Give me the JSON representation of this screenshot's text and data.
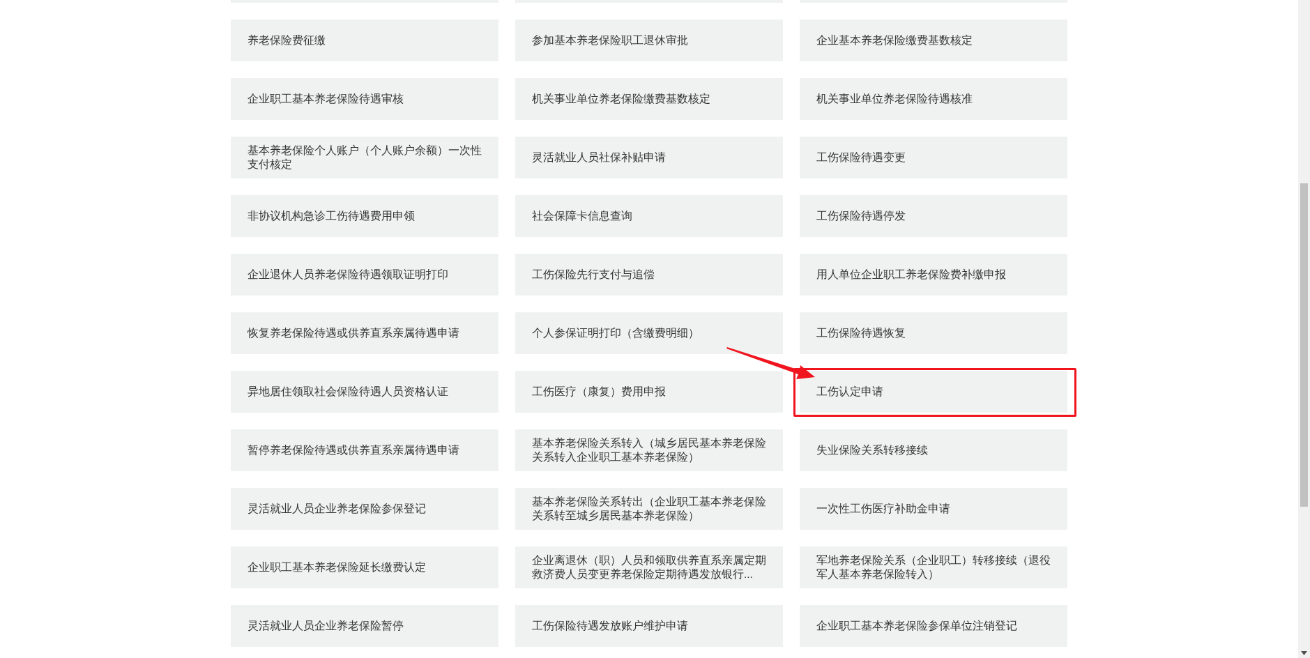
{
  "rows": [
    {
      "services": [
        {
          "label": "养老保险费征缴",
          "highlighted": false
        },
        {
          "label": "参加基本养老保险职工退休审批",
          "highlighted": false
        },
        {
          "label": "企业基本养老保险缴费基数核定",
          "highlighted": false
        }
      ]
    },
    {
      "services": [
        {
          "label": "企业职工基本养老保险待遇审核",
          "highlighted": false
        },
        {
          "label": "机关事业单位养老保险缴费基数核定",
          "highlighted": false
        },
        {
          "label": "机关事业单位养老保险待遇核准",
          "highlighted": false
        }
      ]
    },
    {
      "services": [
        {
          "label": "基本养老保险个人账户（个人账户余额）一次性支付核定",
          "highlighted": false
        },
        {
          "label": "灵活就业人员社保补贴申请",
          "highlighted": false
        },
        {
          "label": "工伤保险待遇变更",
          "highlighted": false
        }
      ]
    },
    {
      "services": [
        {
          "label": "非协议机构急诊工伤待遇费用申领",
          "highlighted": false
        },
        {
          "label": "社会保障卡信息查询",
          "highlighted": false
        },
        {
          "label": "工伤保险待遇停发",
          "highlighted": false
        }
      ]
    },
    {
      "services": [
        {
          "label": "企业退休人员养老保险待遇领取证明打印",
          "highlighted": false
        },
        {
          "label": "工伤保险先行支付与追偿",
          "highlighted": false
        },
        {
          "label": "用人单位企业职工养老保险费补缴申报",
          "highlighted": false
        }
      ]
    },
    {
      "services": [
        {
          "label": "恢复养老保险待遇或供养直系亲属待遇申请",
          "highlighted": false
        },
        {
          "label": "个人参保证明打印（含缴费明细）",
          "highlighted": false
        },
        {
          "label": "工伤保险待遇恢复",
          "highlighted": false
        }
      ]
    },
    {
      "services": [
        {
          "label": "异地居住领取社会保险待遇人员资格认证",
          "highlighted": false
        },
        {
          "label": "工伤医疗（康复）费用申报",
          "highlighted": false
        },
        {
          "label": "工伤认定申请",
          "highlighted": true
        }
      ]
    },
    {
      "services": [
        {
          "label": "暂停养老保险待遇或供养直系亲属待遇申请",
          "highlighted": false
        },
        {
          "label": "基本养老保险关系转入（城乡居民基本养老保险关系转入企业职工基本养老保险）",
          "highlighted": false
        },
        {
          "label": "失业保险关系转移接续",
          "highlighted": false
        }
      ]
    },
    {
      "services": [
        {
          "label": "灵活就业人员企业养老保险参保登记",
          "highlighted": false
        },
        {
          "label": "基本养老保险关系转出（企业职工基本养老保险关系转至城乡居民基本养老保险）",
          "highlighted": false
        },
        {
          "label": "一次性工伤医疗补助金申请",
          "highlighted": false
        }
      ]
    },
    {
      "services": [
        {
          "label": "企业职工基本养老保险延长缴费认定",
          "highlighted": false
        },
        {
          "label": "企业离退休（职）人员和领取供养直系亲属定期救济费人员变更养老保险定期待遇发放银行...",
          "highlighted": false
        },
        {
          "label": "军地养老保险关系（企业职工）转移接续（退役军人基本养老保险转入）",
          "highlighted": false
        }
      ]
    },
    {
      "services": [
        {
          "label": "灵活就业人员企业养老保险暂停",
          "highlighted": false
        },
        {
          "label": "工伤保险待遇发放账户维护申请",
          "highlighted": false
        },
        {
          "label": "企业职工基本养老保险参保单位注销登记",
          "highlighted": false
        }
      ]
    }
  ]
}
